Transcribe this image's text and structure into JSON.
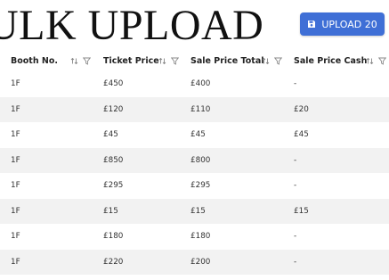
{
  "page": {
    "title": "ULK UPLOAD",
    "upload_button_label": "UPLOAD 20"
  },
  "table": {
    "headers": [
      "Booth No.",
      "Ticket Price",
      "Sale Price Total",
      "Sale Price Cash"
    ],
    "rows": [
      [
        "1F",
        "£450",
        "£400",
        "-"
      ],
      [
        "1F",
        "£120",
        "£110",
        "£20"
      ],
      [
        "1F",
        "£45",
        "£45",
        "£45"
      ],
      [
        "1F",
        "£850",
        "£800",
        "-"
      ],
      [
        "1F",
        "£295",
        "£295",
        "-"
      ],
      [
        "1F",
        "£15",
        "£15",
        "£15"
      ],
      [
        "1F",
        "£180",
        "£180",
        "-"
      ],
      [
        "1F",
        "£220",
        "£200",
        "-"
      ]
    ]
  },
  "colors": {
    "accent": "#3f6fd6",
    "row_alt": "#f2f2f2"
  },
  "icons": [
    "save-icon",
    "sort-icon",
    "filter-icon"
  ]
}
